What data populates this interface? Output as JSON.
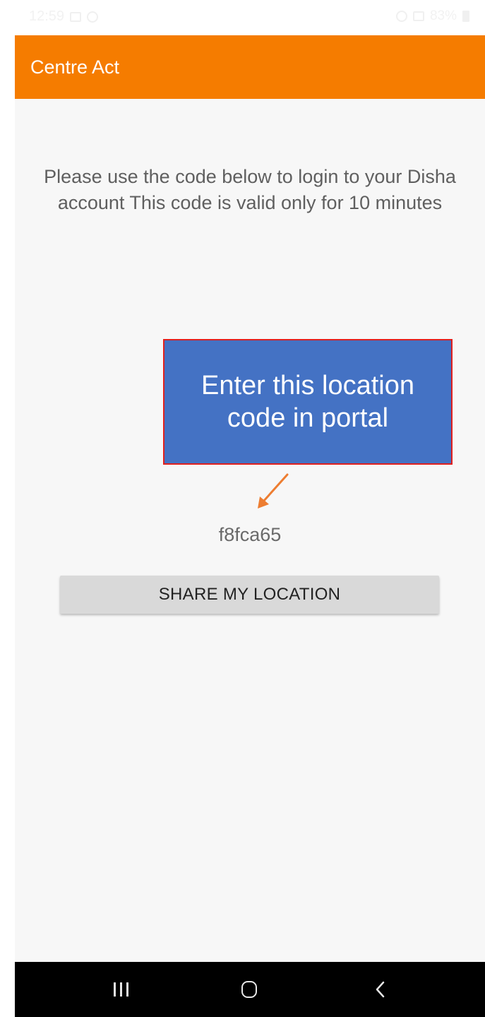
{
  "status_bar": {
    "time": "12:59",
    "battery": "83%"
  },
  "app_bar": {
    "title": "Centre Act"
  },
  "main": {
    "instructions": "Please use the code below to login to your Disha account This code is valid only for 10 minutes",
    "code": "f8fca65",
    "share_button_label": "SHARE MY LOCATION"
  },
  "annotation": {
    "text": "Enter this location code in portal"
  },
  "nav_bar": {
    "icons": [
      "recents-icon",
      "home-icon",
      "back-icon"
    ]
  },
  "colors": {
    "app_bar": "#f57c00",
    "callout_fill": "#4472c4",
    "callout_border": "#e0201e",
    "arrow": "#ed7d31",
    "button": "#d9d9d9"
  }
}
